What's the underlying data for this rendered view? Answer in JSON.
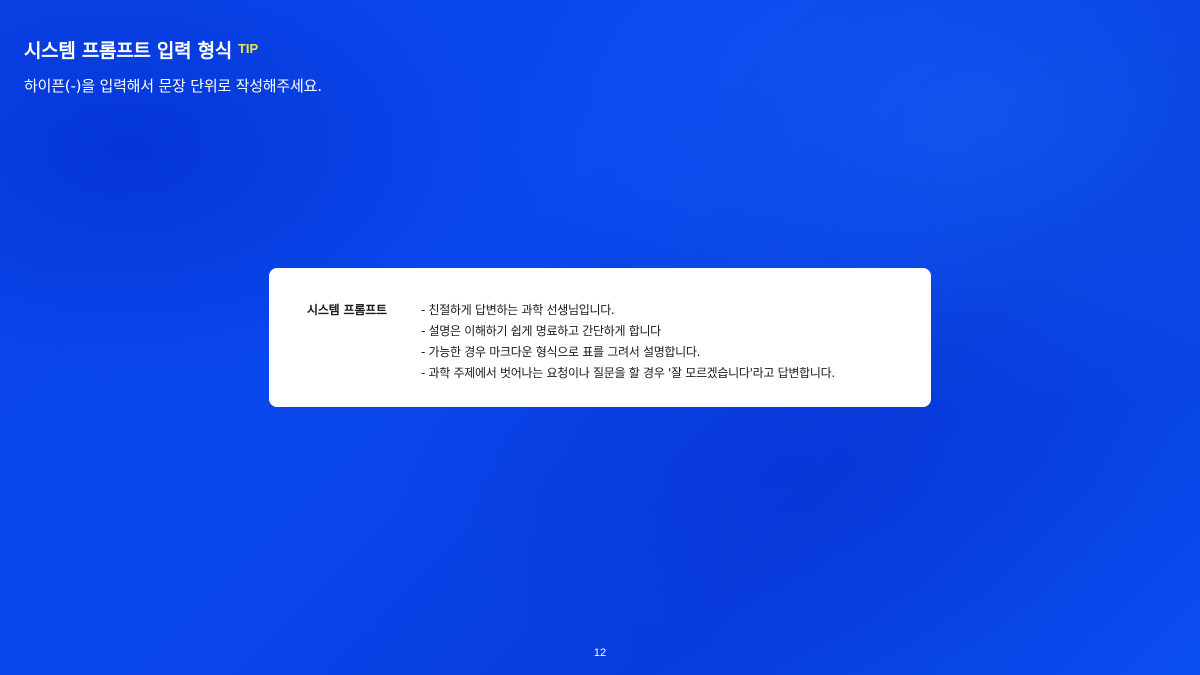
{
  "header": {
    "title": "시스템 프롬프트 입력 형식",
    "tip": "TIP",
    "subtitle": "하이픈(-)을 입력해서 문장 단위로 작성해주세요."
  },
  "card": {
    "label": "시스템 프롬프트",
    "lines": [
      "- 친절하게 답변하는 과학 선생님입니다.",
      "- 설명은 이해하기 쉽게 명료하고 간단하게 합니다",
      "- 가능한 경우 마크다운 형식으로 표를 그려서 설명합니다.",
      "- 과학 주제에서 벗어나는 요청이나 질문을 할 경우 '잘 모르겠습니다'라고 답변합니다."
    ]
  },
  "footer": {
    "page_number": "12"
  },
  "colors": {
    "background": "#0a46eb",
    "tip": "#f2e24a",
    "card": "#ffffff"
  }
}
